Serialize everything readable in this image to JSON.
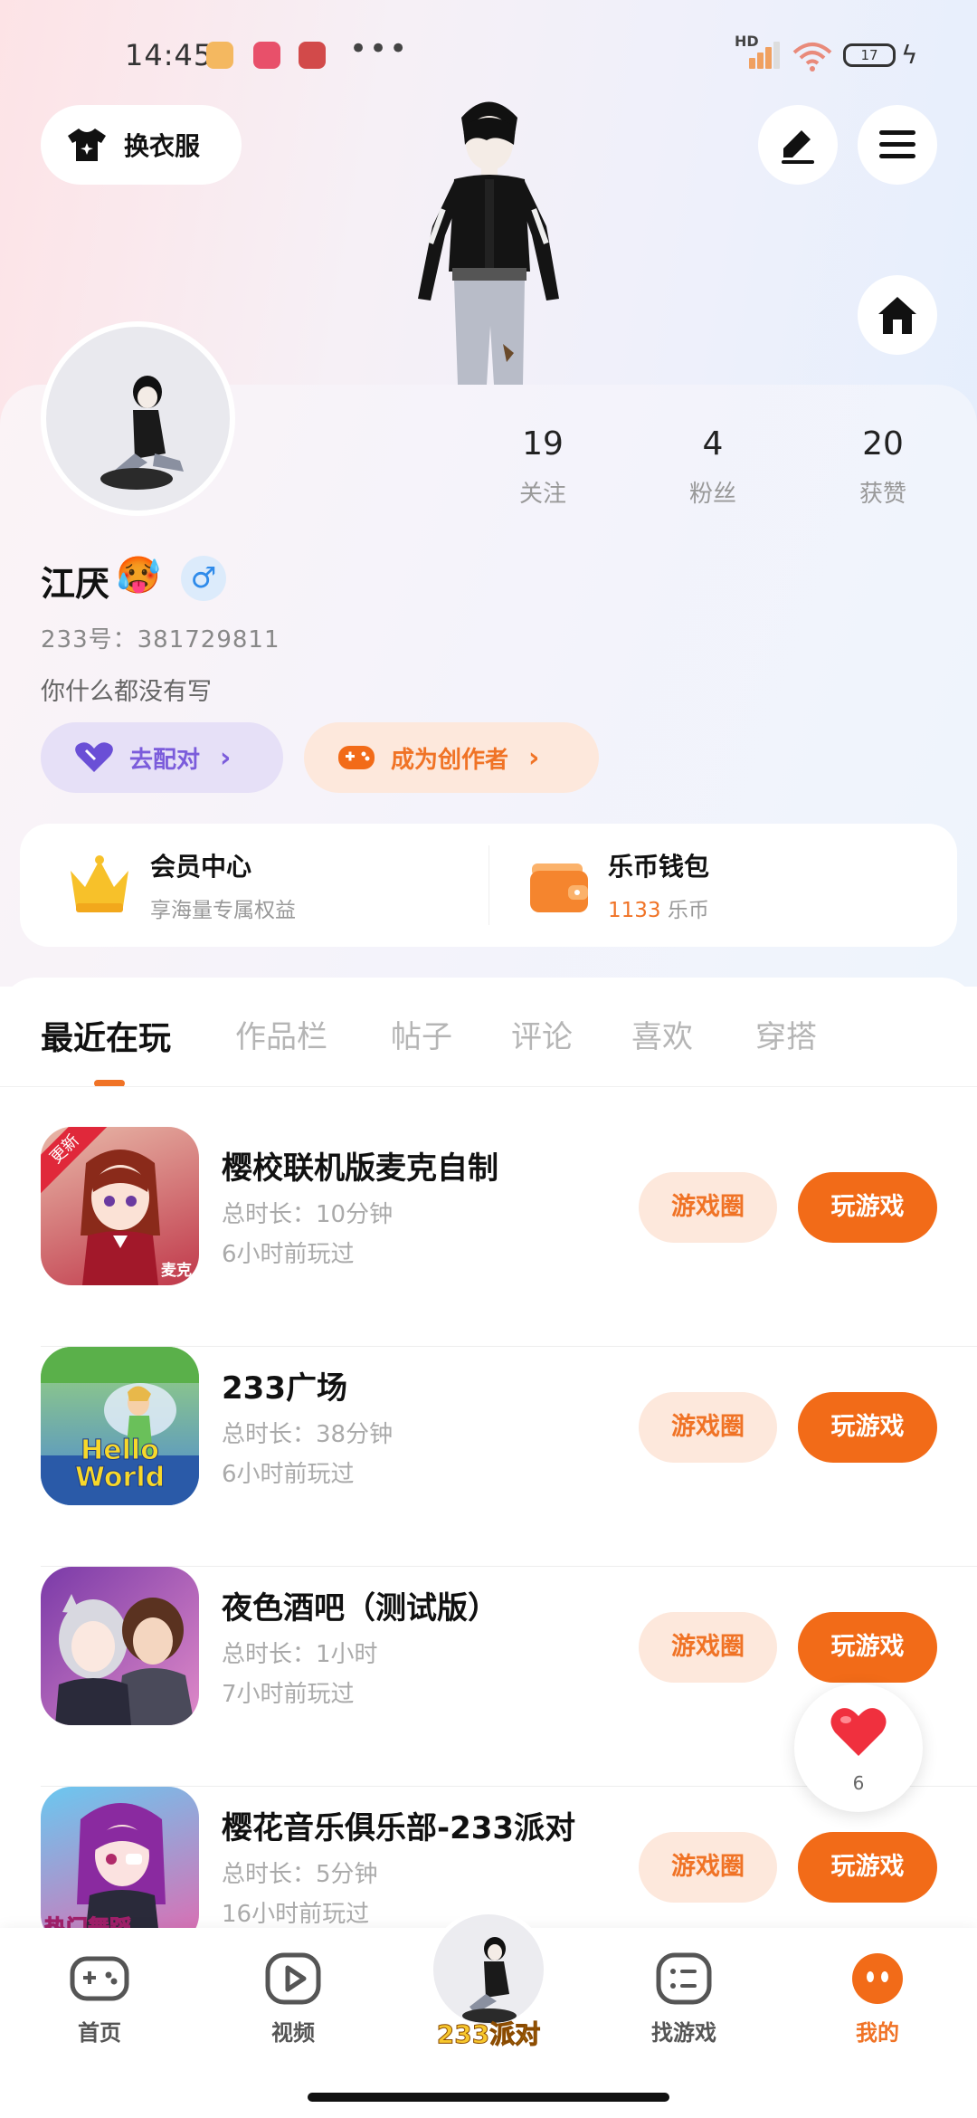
{
  "status_bar": {
    "time": "14:45",
    "dots": "•••",
    "hd": "HD",
    "battery": "17"
  },
  "header": {
    "outfit_label": "换衣服"
  },
  "profile": {
    "stats": [
      {
        "value": "19",
        "label": "关注"
      },
      {
        "value": "4",
        "label": "粉丝"
      },
      {
        "value": "20",
        "label": "获赞"
      }
    ],
    "username": "江厌",
    "emoji": "🥵",
    "gender_symbol": "♂",
    "uid": "233号：381729811",
    "bio": "你什么都没有写",
    "match_label": "去配对",
    "creator_label": "成为创作者",
    "arrow": "›"
  },
  "cards": {
    "vip": {
      "title": "会员中心",
      "subtitle": "享海量专属权益"
    },
    "wallet": {
      "title": "乐币钱包",
      "amount": "1133",
      "unit": "乐币"
    }
  },
  "tabs": [
    "最近在玩",
    "作品栏",
    "帖子",
    "评论",
    "喜欢",
    "穿搭"
  ],
  "games": [
    {
      "name": "樱校联机版麦克自制",
      "duration": "总时长：10分钟",
      "last_played": "6小时前玩过",
      "badge": "更新",
      "icon_text": "麦克"
    },
    {
      "name": "233广场",
      "duration": "总时长：38分钟",
      "last_played": "6小时前玩过",
      "icon_text": "Hello World"
    },
    {
      "name": "夜色酒吧（测试版）",
      "duration": "总时长：1小时",
      "last_played": "7小时前玩过"
    },
    {
      "name": "樱花音乐俱乐部-233派对",
      "duration": "总时长：5分钟",
      "last_played": "16小时前玩过",
      "icon_text": "热门舞蹈"
    }
  ],
  "game_buttons": {
    "circle": "游戏圈",
    "play": "玩游戏"
  },
  "float_heart": {
    "count": "6"
  },
  "bottom_nav": {
    "items": [
      "首页",
      "视频",
      "找游戏",
      "我的"
    ],
    "center_label": "233派对"
  },
  "colors": {
    "accent": "#f26b18",
    "accent_light": "#fde8dc",
    "purple": "#7b5cdb"
  }
}
